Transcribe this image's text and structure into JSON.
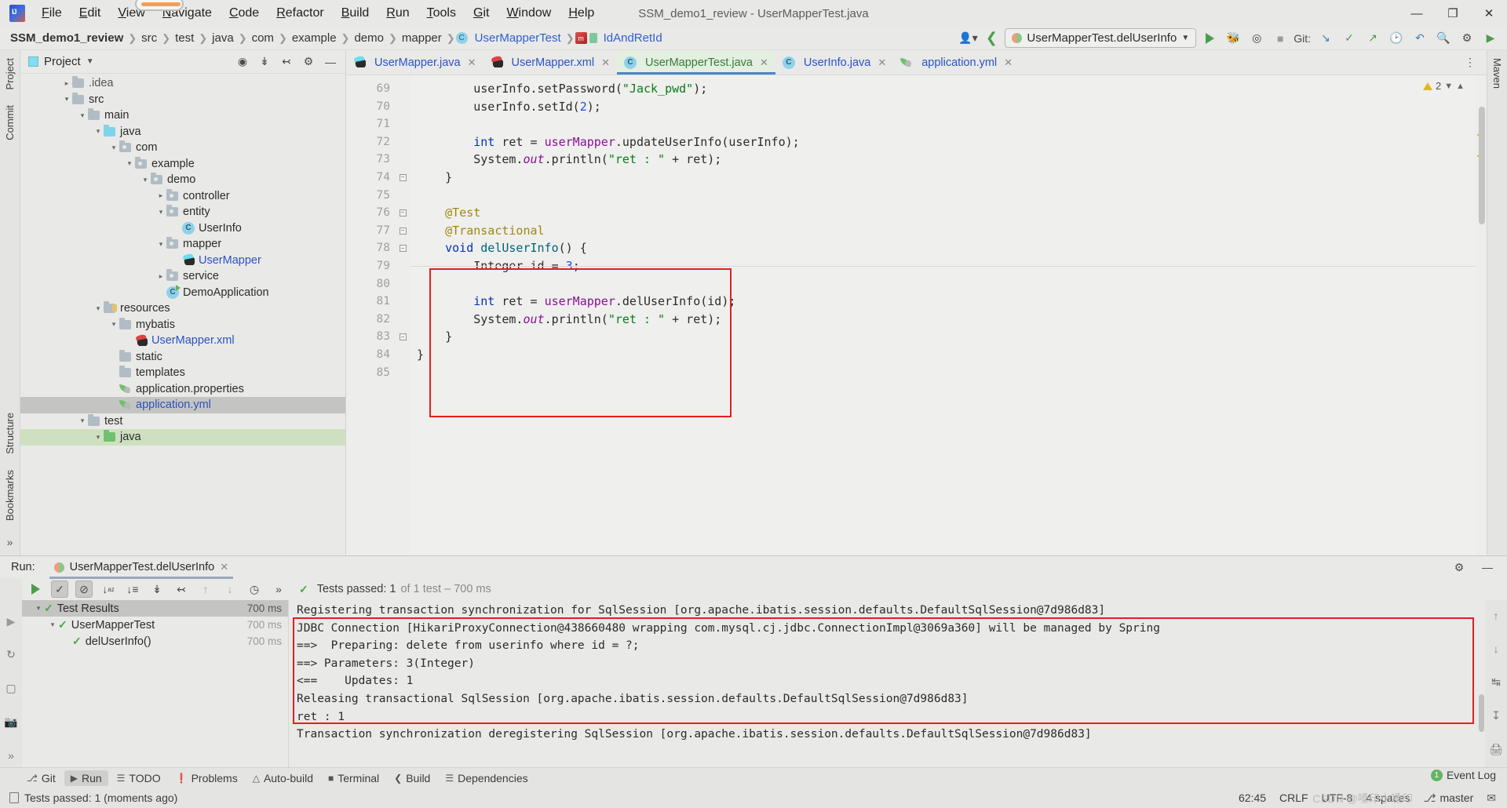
{
  "window": {
    "title": "SSM_demo1_review - UserMapperTest.java",
    "controls": {
      "minimize": "—",
      "maximize": "❐",
      "close": "✕"
    }
  },
  "menu": {
    "items": [
      {
        "label": "File",
        "mnemonic": "F"
      },
      {
        "label": "Edit",
        "mnemonic": "E"
      },
      {
        "label": "View",
        "mnemonic": "V"
      },
      {
        "label": "Navigate",
        "mnemonic": "N"
      },
      {
        "label": "Code",
        "mnemonic": "C"
      },
      {
        "label": "Refactor",
        "mnemonic": "R"
      },
      {
        "label": "Build",
        "mnemonic": "B"
      },
      {
        "label": "Run",
        "mnemonic": "R"
      },
      {
        "label": "Tools",
        "mnemonic": "T"
      },
      {
        "label": "Git",
        "mnemonic": "G"
      },
      {
        "label": "Window",
        "mnemonic": "W"
      },
      {
        "label": "Help",
        "mnemonic": "H"
      }
    ]
  },
  "breadcrumb": {
    "items": [
      {
        "label": "SSM_demo1_review",
        "kind": "project"
      },
      {
        "label": "src",
        "kind": "folder"
      },
      {
        "label": "test",
        "kind": "folder"
      },
      {
        "label": "java",
        "kind": "folder"
      },
      {
        "label": "com",
        "kind": "folder"
      },
      {
        "label": "example",
        "kind": "folder"
      },
      {
        "label": "demo",
        "kind": "folder"
      },
      {
        "label": "mapper",
        "kind": "folder"
      },
      {
        "label": "UserMapperTest",
        "kind": "class"
      },
      {
        "label": "IdAndRetId",
        "kind": "xml-method"
      }
    ]
  },
  "toolbar": {
    "run_config": "UserMapperTest.delUserInfo",
    "git_label": "Git:",
    "icons": [
      "user-avatar-icon",
      "back-arrow-icon",
      "run-icon",
      "debug-icon",
      "run-coverage-icon",
      "stop-icon",
      "git-update-icon",
      "git-commit-icon",
      "git-push-icon",
      "git-history-icon",
      "undo-icon",
      "search-icon",
      "settings-icon",
      "ide-updates-icon"
    ]
  },
  "project_panel": {
    "title": "Project",
    "tools": [
      "target-icon",
      "collapse-all-icon",
      "expand-all-icon",
      "settings-icon",
      "hide-icon"
    ],
    "tree": [
      {
        "label": ".idea",
        "indent": 2,
        "arrow": "collapsed",
        "icon": "folder",
        "style": "dim"
      },
      {
        "label": "src",
        "indent": 2,
        "arrow": "expanded",
        "icon": "folder",
        "style": "normal"
      },
      {
        "label": "main",
        "indent": 3,
        "arrow": "expanded",
        "icon": "folder",
        "style": "normal"
      },
      {
        "label": "java",
        "indent": 4,
        "arrow": "expanded",
        "icon": "folder-blue",
        "style": "normal"
      },
      {
        "label": "com",
        "indent": 5,
        "arrow": "expanded",
        "icon": "folder-pkg",
        "style": "normal"
      },
      {
        "label": "example",
        "indent": 6,
        "arrow": "expanded",
        "icon": "folder-pkg",
        "style": "normal"
      },
      {
        "label": "demo",
        "indent": 7,
        "arrow": "expanded",
        "icon": "folder-pkg",
        "style": "normal"
      },
      {
        "label": "controller",
        "indent": 8,
        "arrow": "collapsed",
        "icon": "folder-pkg",
        "style": "normal"
      },
      {
        "label": "entity",
        "indent": 8,
        "arrow": "expanded",
        "icon": "folder-pkg",
        "style": "normal"
      },
      {
        "label": "UserInfo",
        "indent": 9,
        "arrow": "none",
        "icon": "java-class",
        "style": "normal"
      },
      {
        "label": "mapper",
        "indent": 8,
        "arrow": "expanded",
        "icon": "folder-pkg",
        "style": "normal"
      },
      {
        "label": "UserMapper",
        "indent": 9,
        "arrow": "none",
        "icon": "mybatis-java",
        "style": "link"
      },
      {
        "label": "service",
        "indent": 8,
        "arrow": "collapsed",
        "icon": "folder-pkg",
        "style": "normal"
      },
      {
        "label": "DemoApplication",
        "indent": 8,
        "arrow": "none",
        "icon": "spring-class",
        "style": "normal"
      },
      {
        "label": "resources",
        "indent": 4,
        "arrow": "expanded",
        "icon": "folder-res",
        "style": "normal"
      },
      {
        "label": "mybatis",
        "indent": 5,
        "arrow": "expanded",
        "icon": "folder",
        "style": "normal"
      },
      {
        "label": "UserMapper.xml",
        "indent": 6,
        "arrow": "none",
        "icon": "mybatis-xml",
        "style": "link"
      },
      {
        "label": "static",
        "indent": 5,
        "arrow": "none",
        "icon": "folder",
        "style": "normal"
      },
      {
        "label": "templates",
        "indent": 5,
        "arrow": "none",
        "icon": "folder",
        "style": "normal"
      },
      {
        "label": "application.properties",
        "indent": 5,
        "arrow": "none",
        "icon": "spring-leaf",
        "style": "normal"
      },
      {
        "label": "application.yml",
        "indent": 5,
        "arrow": "none",
        "icon": "spring-leaf",
        "style": "link",
        "selected": true
      },
      {
        "label": "test",
        "indent": 3,
        "arrow": "expanded",
        "icon": "folder",
        "style": "normal"
      },
      {
        "label": "java",
        "indent": 4,
        "arrow": "expanded",
        "icon": "folder-green",
        "style": "normal",
        "green_selected": true
      }
    ]
  },
  "editor": {
    "tabs": [
      {
        "label": "UserMapper.java",
        "icon": "mybatis-java-icon",
        "active": false
      },
      {
        "label": "UserMapper.xml",
        "icon": "mybatis-xml-icon",
        "active": false
      },
      {
        "label": "UserMapperTest.java",
        "icon": "java-class-icon",
        "active": true
      },
      {
        "label": "UserInfo.java",
        "icon": "java-class-icon",
        "active": false
      },
      {
        "label": "application.yml",
        "icon": "spring-leaf-icon",
        "active": false
      }
    ],
    "warning_count": "2",
    "first_line_number": 69,
    "lines": [
      {
        "n": 69,
        "indent": 2,
        "tokens": [
          {
            "t": "userInfo.setPassword(",
            "c": "plain"
          },
          {
            "t": "\"Jack_pwd\"",
            "c": "str"
          },
          {
            "t": ");",
            "c": "plain"
          }
        ]
      },
      {
        "n": 70,
        "indent": 2,
        "tokens": [
          {
            "t": "userInfo.setId(",
            "c": "plain"
          },
          {
            "t": "2",
            "c": "num"
          },
          {
            "t": ");",
            "c": "plain"
          }
        ]
      },
      {
        "n": 71,
        "indent": 0,
        "tokens": []
      },
      {
        "n": 72,
        "indent": 2,
        "tokens": [
          {
            "t": "int",
            "c": "kw"
          },
          {
            "t": " ret = ",
            "c": "plain"
          },
          {
            "t": "userMapper",
            "c": "fld"
          },
          {
            "t": ".updateUserInfo(userInfo);",
            "c": "plain"
          }
        ]
      },
      {
        "n": 73,
        "indent": 2,
        "tokens": [
          {
            "t": "System.",
            "c": "plain"
          },
          {
            "t": "out",
            "c": "stat"
          },
          {
            "t": ".println(",
            "c": "plain"
          },
          {
            "t": "\"ret : \"",
            "c": "str"
          },
          {
            "t": " + ret);",
            "c": "plain"
          }
        ]
      },
      {
        "n": 74,
        "indent": 1,
        "tokens": [
          {
            "t": "}",
            "c": "plain"
          }
        ],
        "fold": true
      },
      {
        "n": 75,
        "indent": 0,
        "tokens": []
      },
      {
        "n": 76,
        "indent": 1,
        "tokens": [
          {
            "t": "@Test",
            "c": "ann"
          }
        ],
        "fold": true,
        "boxed": true
      },
      {
        "n": 77,
        "indent": 1,
        "tokens": [
          {
            "t": "@Transactional",
            "c": "ann"
          }
        ],
        "fold": true,
        "boxed": true
      },
      {
        "n": 78,
        "indent": 1,
        "tokens": [
          {
            "t": "void",
            "c": "kw"
          },
          {
            "t": " ",
            "c": "plain"
          },
          {
            "t": "delUserInfo",
            "c": "mth"
          },
          {
            "t": "() {",
            "c": "plain"
          }
        ],
        "fold": true,
        "boxed": true,
        "gutter_icon": "run-test-icon"
      },
      {
        "n": 79,
        "indent": 2,
        "tokens": [
          {
            "t": "Integer id = ",
            "c": "plain"
          },
          {
            "t": "3",
            "c": "num"
          },
          {
            "t": ";",
            "c": "plain"
          }
        ],
        "boxed": true
      },
      {
        "n": 80,
        "indent": 0,
        "tokens": [],
        "boxed": true
      },
      {
        "n": 81,
        "indent": 2,
        "tokens": [
          {
            "t": "int",
            "c": "kw"
          },
          {
            "t": " ret = ",
            "c": "plain"
          },
          {
            "t": "userMapper",
            "c": "fld"
          },
          {
            "t": ".delUserInfo(id);",
            "c": "plain"
          }
        ],
        "boxed": true
      },
      {
        "n": 82,
        "indent": 2,
        "tokens": [
          {
            "t": "System.",
            "c": "plain"
          },
          {
            "t": "out",
            "c": "stat"
          },
          {
            "t": ".println(",
            "c": "plain"
          },
          {
            "t": "\"ret : \"",
            "c": "str"
          },
          {
            "t": " + ret);",
            "c": "plain"
          }
        ],
        "boxed": true
      },
      {
        "n": 83,
        "indent": 1,
        "tokens": [
          {
            "t": "}",
            "c": "plain"
          }
        ],
        "fold": true,
        "boxed": true
      },
      {
        "n": 84,
        "indent": 0,
        "tokens": [
          {
            "t": "}",
            "c": "plain"
          }
        ]
      },
      {
        "n": 85,
        "indent": 0,
        "tokens": []
      }
    ]
  },
  "run_panel": {
    "label": "Run:",
    "config_name": "UserMapperTest.delUserInfo",
    "toolbar_icons": [
      "rerun-icon",
      "show-passed-icon",
      "show-ignored-icon",
      "sort-alpha-icon",
      "sort-duration-icon",
      "expand-all-icon",
      "collapse-all-icon",
      "prev-failed-icon",
      "next-failed-icon",
      "history-icon",
      "more-icon"
    ],
    "status": "Tests passed: 1",
    "status_detail": "of 1 test – 700 ms",
    "tests": [
      {
        "label": "Test Results",
        "indent": 0,
        "arrow": "expanded",
        "time": "700 ms",
        "selected": true,
        "dim": false
      },
      {
        "label": "UserMapperTest",
        "indent": 1,
        "arrow": "expanded",
        "time": "700 ms",
        "selected": false,
        "dim": true
      },
      {
        "label": "delUserInfo()",
        "indent": 2,
        "arrow": "none",
        "time": "700 ms",
        "selected": false,
        "dim": true
      }
    ],
    "console": [
      {
        "text": "Registering transaction synchronization for SqlSession [org.apache.ibatis.session.defaults.DefaultSqlSession@7d986d83]",
        "boxed": false
      },
      {
        "text": "JDBC Connection [HikariProxyConnection@438660480 wrapping com.mysql.cj.jdbc.ConnectionImpl@3069a360] will be managed by Spring",
        "boxed": true
      },
      {
        "text": "==>  Preparing: delete from userinfo where id = ?;",
        "boxed": true
      },
      {
        "text": "==> Parameters: 3(Integer)",
        "boxed": true
      },
      {
        "text": "<==    Updates: 1",
        "boxed": true
      },
      {
        "text": "Releasing transactional SqlSession [org.apache.ibatis.session.defaults.DefaultSqlSession@7d986d83]",
        "boxed": true
      },
      {
        "text": "ret : 1",
        "boxed": true
      },
      {
        "text": "Transaction synchronization deregistering SqlSession [org.apache.ibatis.session.defaults.DefaultSqlSession@7d986d83]",
        "boxed": false
      }
    ]
  },
  "tool_buttons": [
    {
      "label": "Git",
      "icon": "git-branch-icon",
      "active": false
    },
    {
      "label": "Run",
      "icon": "run-icon",
      "active": true
    },
    {
      "label": "TODO",
      "icon": "todo-list-icon",
      "active": false
    },
    {
      "label": "Problems",
      "icon": "problems-icon",
      "active": false
    },
    {
      "label": "Auto-build",
      "icon": "auto-build-icon",
      "active": false
    },
    {
      "label": "Terminal",
      "icon": "terminal-icon",
      "active": false
    },
    {
      "label": "Build",
      "icon": "build-hammer-icon",
      "active": false
    },
    {
      "label": "Dependencies",
      "icon": "dependencies-icon",
      "active": false
    }
  ],
  "left_strip": {
    "tabs": [
      "Project",
      "Commit",
      "Structure",
      "Bookmarks"
    ]
  },
  "right_strip": {
    "tabs": [
      "Maven"
    ]
  },
  "status_bar": {
    "message": "Tests passed: 1 (moments ago)",
    "event_log": "Event Log",
    "event_count": "1",
    "caret_position": "62:45",
    "line_separator": "CRLF",
    "encoding": "UTF-8",
    "indent": "4 spaces",
    "branch": "master",
    "watermark": "CSDN @嗓印小嗓印"
  },
  "colors": {
    "accent_blue": "#2a52c4",
    "highlight_red": "#e02020",
    "success_green": "#4aa54a",
    "tab_active_bg": "#e3efe0",
    "selection_gray": "#c4c4c2",
    "selection_green": "#cfe0c0"
  }
}
